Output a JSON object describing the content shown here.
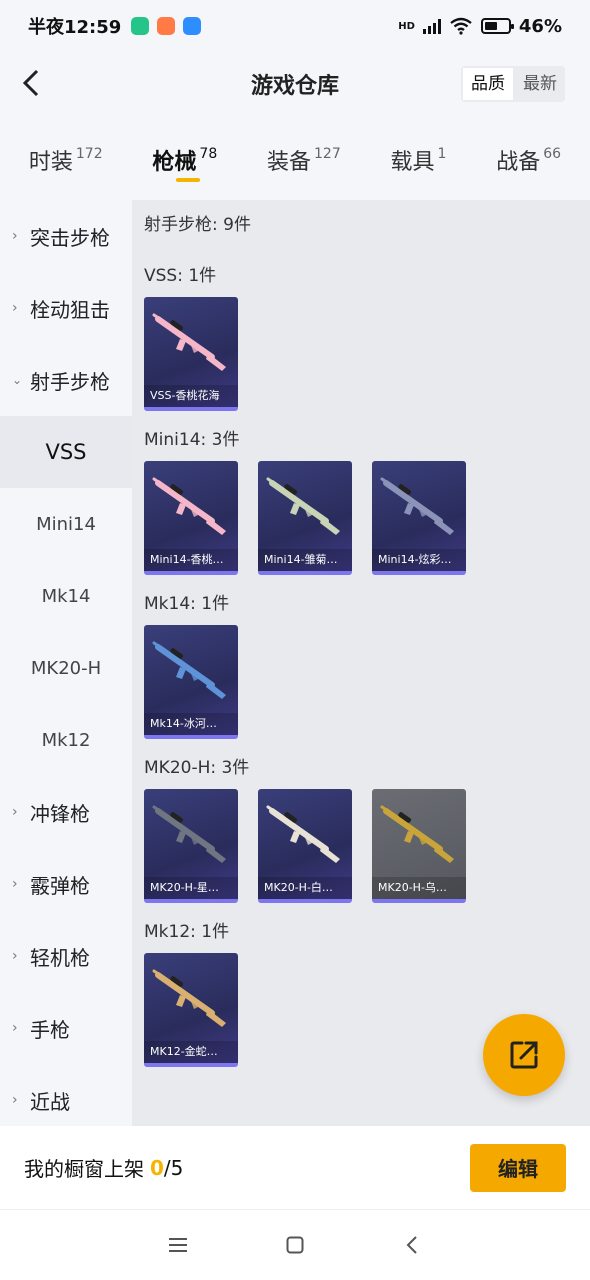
{
  "status_bar": {
    "time": "半夜12:59",
    "network": "HD",
    "battery": "46%",
    "app_icon_colors": [
      "#25c58a",
      "#ff7a45",
      "#2e8dff"
    ]
  },
  "header": {
    "title": "游戏仓库",
    "sort_options": [
      "品质",
      "最新"
    ],
    "sort_active": "品质"
  },
  "tabs": [
    {
      "label": "时装",
      "count": "172"
    },
    {
      "label": "枪械",
      "count": "78",
      "active": true
    },
    {
      "label": "装备",
      "count": "127"
    },
    {
      "label": "载具",
      "count": "1"
    },
    {
      "label": "战备",
      "count": "66"
    }
  ],
  "sidebar": {
    "items": [
      {
        "label": "突击步枪",
        "expanded": false
      },
      {
        "label": "栓动狙击",
        "expanded": false
      },
      {
        "label": "射手步枪",
        "expanded": true
      },
      {
        "label": "VSS",
        "sub": true,
        "active": true
      },
      {
        "label": "Mini14",
        "sub": true
      },
      {
        "label": "Mk14",
        "sub": true
      },
      {
        "label": "MK20-H",
        "sub": true
      },
      {
        "label": "Mk12",
        "sub": true
      },
      {
        "label": "冲锋枪",
        "expanded": false
      },
      {
        "label": "霰弹枪",
        "expanded": false
      },
      {
        "label": "轻机枪",
        "expanded": false
      },
      {
        "label": "手枪",
        "expanded": false
      },
      {
        "label": "近战",
        "expanded": false
      }
    ]
  },
  "content": {
    "total": "射手步枪: 9件",
    "groups": [
      {
        "title": "VSS: 1件",
        "items": [
          {
            "name": "VSS-香桃花海",
            "color": "#f4b6c8",
            "bg": "purple"
          }
        ]
      },
      {
        "title": "Mini14: 3件",
        "items": [
          {
            "name": "Mini14-香桃…",
            "color": "#f4b6c8",
            "bg": "purple"
          },
          {
            "name": "Mini14-雏菊…",
            "color": "#c9d3b6",
            "bg": "purple"
          },
          {
            "name": "Mini14-炫彩…",
            "color": "#8c93b8",
            "bg": "purple"
          }
        ]
      },
      {
        "title": "Mk14: 1件",
        "items": [
          {
            "name": "Mk14-冰河…",
            "color": "#5e93d8",
            "bg": "purple"
          }
        ]
      },
      {
        "title": "MK20-H: 3件",
        "items": [
          {
            "name": "MK20-H-星…",
            "color": "#6f7682",
            "bg": "purple"
          },
          {
            "name": "MK20-H-白…",
            "color": "#e8e2d6",
            "bg": "purple"
          },
          {
            "name": "MK20-H-乌…",
            "color": "#c9a43a",
            "bg": "gray"
          }
        ]
      },
      {
        "title": "Mk12: 1件",
        "items": [
          {
            "name": "MK12-金蛇…",
            "color": "#d9b070",
            "bg": "purple"
          }
        ]
      }
    ]
  },
  "bottom": {
    "shelf_label": "我的橱窗上架",
    "shelf_count": "0",
    "shelf_total": "/5",
    "edit_label": "编辑"
  },
  "colors": {
    "accent": "#f5a800",
    "tab_underline": "#f5b400",
    "card_border": "#7e76ee"
  },
  "icons": {
    "back": "back-arrow-icon",
    "fab": "share-external-icon",
    "nav": [
      "menu-icon",
      "home-square-icon",
      "back-chevron-icon"
    ]
  }
}
